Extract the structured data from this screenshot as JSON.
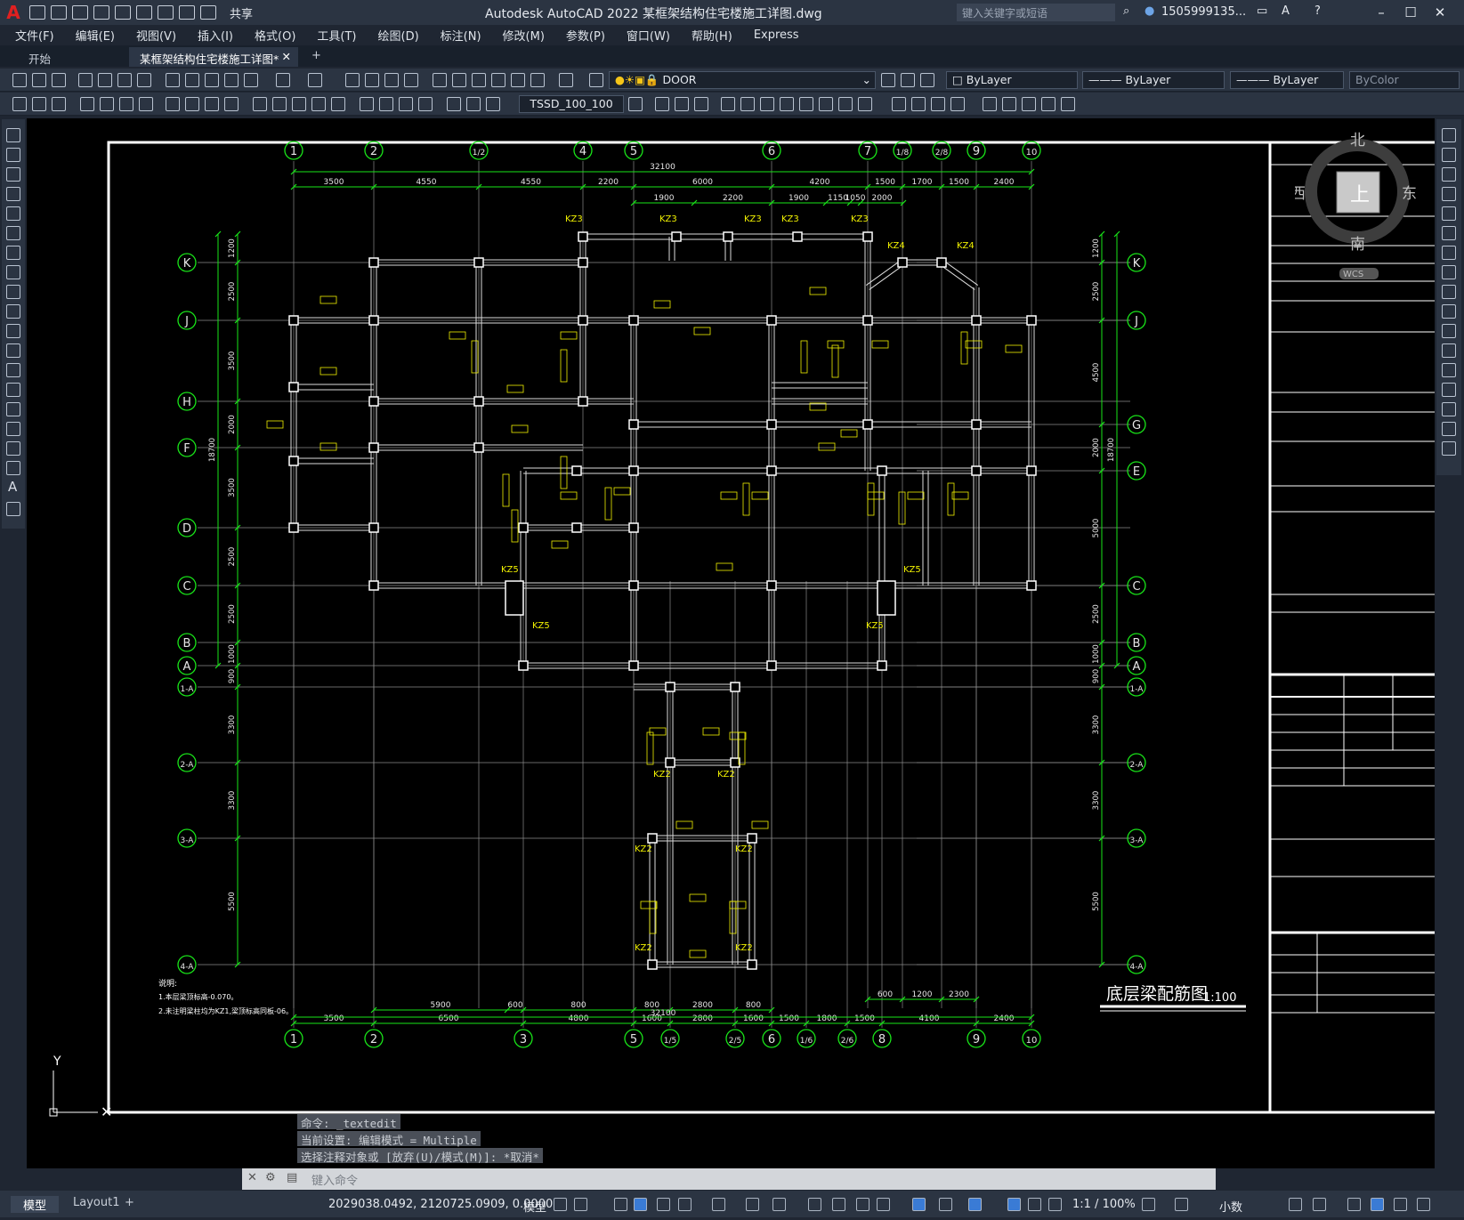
{
  "app": {
    "title": "Autodesk AutoCAD 2022    某框架结构住宅楼施工详图.dwg",
    "search_placeholder": "键入关键字或短语",
    "user": "1505999135...",
    "share": "共享"
  },
  "menu": [
    "文件(F)",
    "编辑(E)",
    "视图(V)",
    "插入(I)",
    "格式(O)",
    "工具(T)",
    "绘图(D)",
    "标注(N)",
    "修改(M)",
    "参数(P)",
    "窗口(W)",
    "帮助(H)",
    "Express"
  ],
  "tabs": {
    "start": "开始",
    "active": "某框架结构住宅楼施工详图*"
  },
  "toolbar": {
    "layer": "DOOR",
    "color": "ByLayer",
    "linetype": "ByLayer",
    "lineweight": "ByLayer",
    "plotstyle": "ByColor",
    "textstyle": "TSSD_100_100"
  },
  "viewcube": {
    "north": "北",
    "south": "南",
    "east": "东",
    "west": "西",
    "face": "上",
    "wcs": "WCS"
  },
  "drawing": {
    "title": "底层梁配筋图",
    "scale": "1:100",
    "top_axes": [
      "1",
      "2",
      "1/2",
      "4",
      "5",
      "6",
      "7",
      "1/8",
      "2/8",
      "9",
      "10"
    ],
    "bottom_axes": [
      "1",
      "2",
      "3",
      "5",
      "1/5",
      "2/5",
      "6",
      "1/6",
      "2/6",
      "8",
      "9",
      "10"
    ],
    "left_axes": [
      "K",
      "J",
      "H",
      "F",
      "D",
      "C",
      "B",
      "A",
      "1-A",
      "2-A",
      "3-A",
      "4-A"
    ],
    "right_axes": [
      "K",
      "J",
      "G",
      "E",
      "C",
      "B",
      "A",
      "1-A",
      "2-A",
      "3-A",
      "4-A"
    ],
    "total_dim": "32100",
    "top_dims": [
      "3500",
      "4550",
      "4550",
      "2200",
      "6000",
      "4200",
      "1500",
      "1700",
      "1500",
      "2400"
    ],
    "top_dims2": [
      "1900",
      "2200",
      "1900",
      "1150",
      "1050",
      "2000"
    ],
    "bottom_dims": [
      "3500",
      "6500",
      "4800",
      "1600",
      "2800",
      "1600",
      "1500",
      "1800",
      "1500",
      "4100",
      "2400"
    ],
    "bottom_dims2": [
      "5900",
      "600",
      "800",
      "800",
      "2800",
      "800",
      "800",
      "600",
      "1200",
      "2300"
    ],
    "left_total": "18700",
    "right_total": "18700",
    "left_dims": [
      "1200",
      "2500",
      "3500",
      "2000",
      "3500",
      "2500",
      "2500",
      "1000",
      "900",
      "3300",
      "3300",
      "5500"
    ],
    "right_dims": [
      "1200",
      "2500",
      "4500",
      "2000",
      "5000",
      "2500",
      "1000",
      "900",
      "3300",
      "3300",
      "5500"
    ],
    "column_labels": [
      "KZ3",
      "KZ3",
      "KZ3",
      "KZ3",
      "KZ3",
      "KZ4",
      "KZ4",
      "KZ5",
      "KZ5",
      "KZ5",
      "KZ5",
      "KZ2",
      "KZ2",
      "KZ2",
      "KZ2",
      "KZ2",
      "KZ2"
    ],
    "notes_title": "说明:",
    "notes": [
      "1.本层梁顶标高-0.070。",
      "2.未注明梁柱均为KZ1,梁顶标高同板-06。"
    ],
    "ucs_y": "Y"
  },
  "command": {
    "history": [
      "命令: _textedit",
      "当前设置: 编辑模式 = Multiple",
      "选择注释对象或 [放弃(U)/模式(M)]: *取消*"
    ],
    "placeholder": "键入命令"
  },
  "status": {
    "model_tab": "模型",
    "layout_tab": "Layout1",
    "coords": "2029038.0492, 2120725.0909, 0.0000",
    "mode": "模型",
    "scale": "1:1 / 100%",
    "units": "小数"
  }
}
